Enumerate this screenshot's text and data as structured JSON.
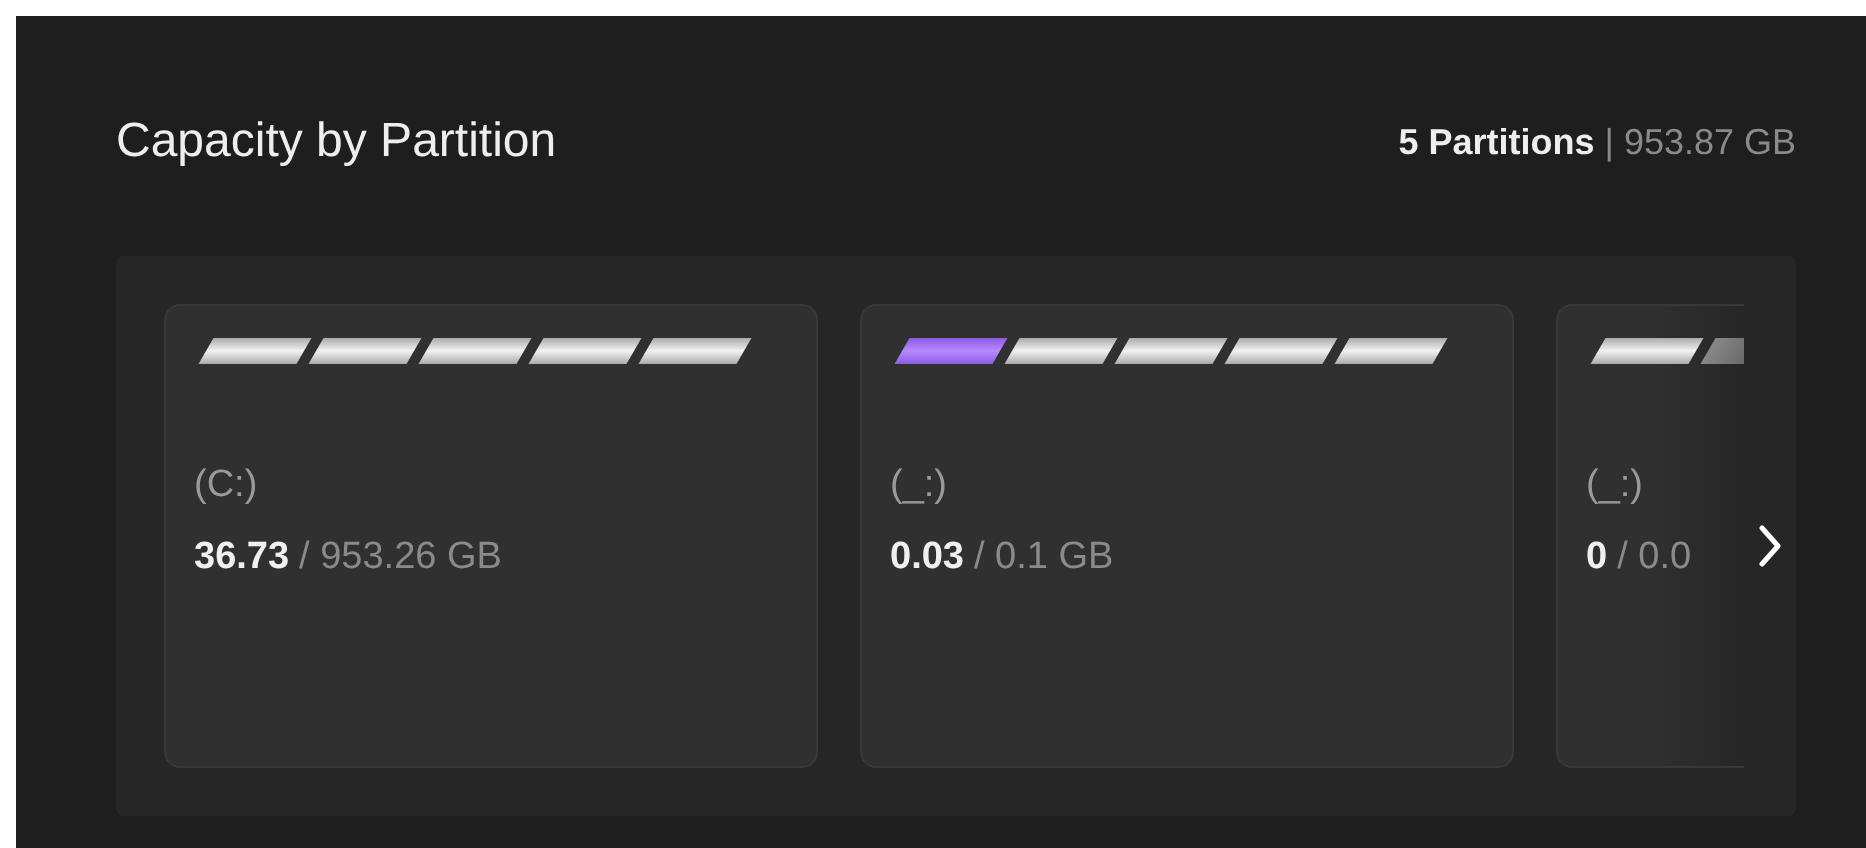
{
  "header": {
    "title": "Capacity by Partition",
    "count": "5 Partitions",
    "separator": "|",
    "total": "953.87 GB"
  },
  "partitions": [
    {
      "label": "(C:)",
      "used": "36.73",
      "capacity": "/ 953.26 GB",
      "segments": [
        {
          "filled": false
        },
        {
          "filled": false
        },
        {
          "filled": false
        },
        {
          "filled": false
        },
        {
          "filled": false
        }
      ]
    },
    {
      "label": "(_:)",
      "used": "0.03",
      "capacity": "/ 0.1 GB",
      "segments": [
        {
          "filled": true
        },
        {
          "filled": false
        },
        {
          "filled": false
        },
        {
          "filled": false
        },
        {
          "filled": false
        }
      ]
    },
    {
      "label": "(_:)",
      "used": "0",
      "capacity": "/ 0.0",
      "segments": [
        {
          "filled": false
        },
        {
          "filled": false
        }
      ]
    }
  ]
}
